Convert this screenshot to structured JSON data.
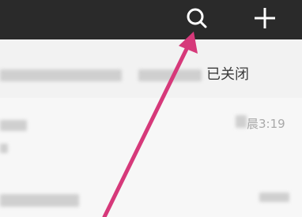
{
  "topbar": {
    "search_icon": "search-icon",
    "add_icon": "plus-icon"
  },
  "notice": {
    "text": "已关闭"
  },
  "chat_list": {
    "items": [
      {
        "time": "晨3:19"
      }
    ]
  },
  "colors": {
    "topbar_bg": "#2a2a2a",
    "icon": "#ffffff",
    "arrow": "#d6397a"
  }
}
